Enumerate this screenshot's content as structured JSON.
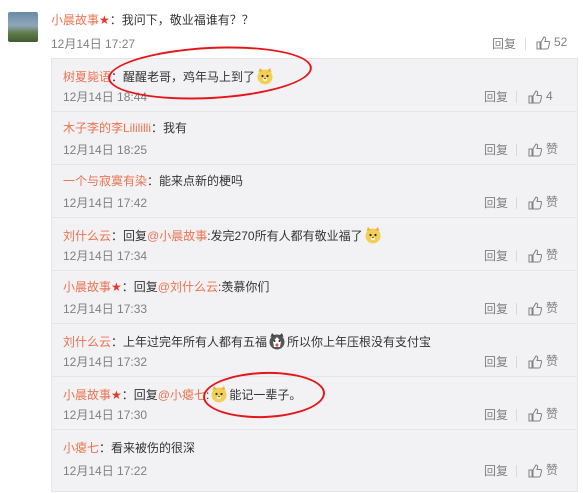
{
  "main_comment": {
    "user": "小晨故事",
    "text": "：我问下，敬业福谁有？？",
    "time": "12月14日 17:27",
    "reply_label": "回复",
    "likes": "52"
  },
  "replies": [
    {
      "user": "树夏毙语",
      "text": "：醒醒老哥，鸡年马上到了",
      "emoji": true,
      "time": "12月14日 18:44",
      "reply_label": "回复",
      "like": "4"
    },
    {
      "user": "木子李的李Lilililli",
      "text": "：我有",
      "time": "12月14日 18:25",
      "reply_label": "回复",
      "like": "赞"
    },
    {
      "user": "一个与寂寞有染",
      "text": "：能来点新的梗吗",
      "time": "12月14日 17:42",
      "reply_label": "回复",
      "like": "赞"
    },
    {
      "user": "刘什么云",
      "pre": "：回复",
      "mention": "@小晨故事",
      "text": ":发完270所有人都有敬业福了",
      "emoji": true,
      "time": "12月14日 17:34",
      "reply_label": "回复",
      "like": "赞"
    },
    {
      "user": "小晨故事",
      "star": true,
      "pre": "：回复",
      "mention": "@刘什么云",
      "text": ":羡慕你们",
      "time": "12月14日 17:33",
      "reply_label": "回复",
      "like": "赞"
    },
    {
      "user": "刘什么云",
      "text": "：上年过完年所有人都有五福",
      "emoji_husky": true,
      "text2": "所以你上年压根没有支付宝",
      "time": "12月14日 17:32",
      "reply_label": "回复",
      "like": "赞"
    },
    {
      "user": "小晨故事",
      "star": true,
      "pre": "：回复",
      "mention": "@小瘪七",
      "text": ":",
      "emoji": true,
      "text2": "能记一辈子。",
      "time": "12月14日 17:30",
      "reply_label": "回复",
      "like": "赞"
    },
    {
      "user": "小瘪七",
      "text": "：看来被伤的很深",
      "time": "12月14日 17:22",
      "reply_label": "回复",
      "like": "赞"
    }
  ],
  "colors": {
    "link": "#eb7350",
    "annotation": "#e5161a",
    "background": "#f2f2f5"
  }
}
